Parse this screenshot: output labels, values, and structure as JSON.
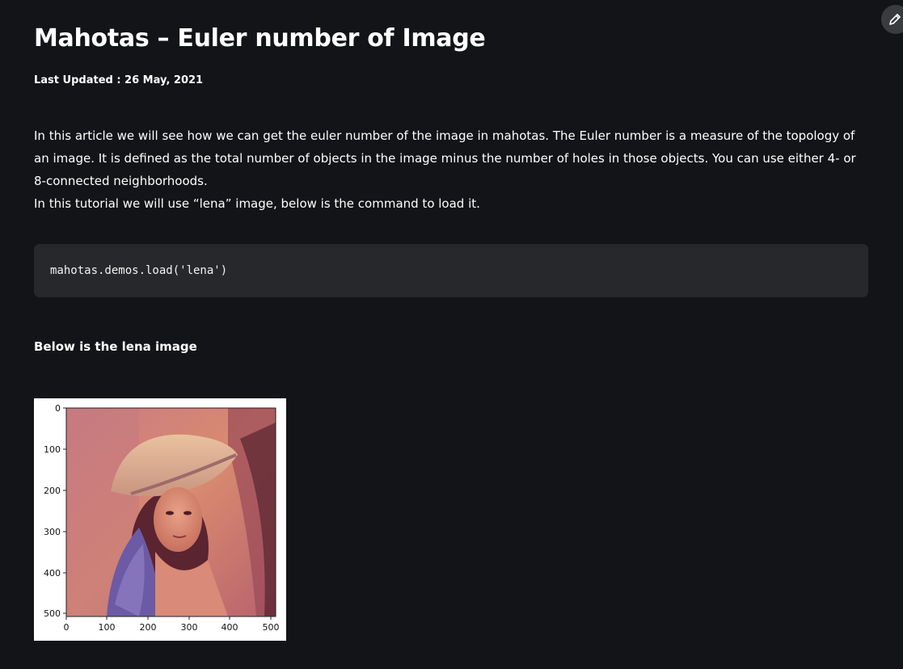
{
  "article": {
    "title": "Mahotas – Euler number of Image",
    "last_updated": "Last Updated : 26 May, 2021",
    "intro_paragraph": "In this article we will see how we can get the euler number of the image in mahotas. The Euler number is a measure of the topology of an image. It is defined as the total number of objects in the image minus the number of holes in those objects. You can use either 4- or 8-connected neighborhoods.",
    "intro_line2": "In this tutorial we will use “lena” image, below is the command to load it.",
    "code": "mahotas.demos.load('lena')",
    "image_caption": "Below is the lena image",
    "edit_icon": "pencil-icon"
  },
  "figure": {
    "x_ticks": [
      "0",
      "100",
      "200",
      "300",
      "400",
      "500"
    ],
    "y_ticks": [
      "0",
      "100",
      "200",
      "300",
      "400",
      "500"
    ]
  }
}
